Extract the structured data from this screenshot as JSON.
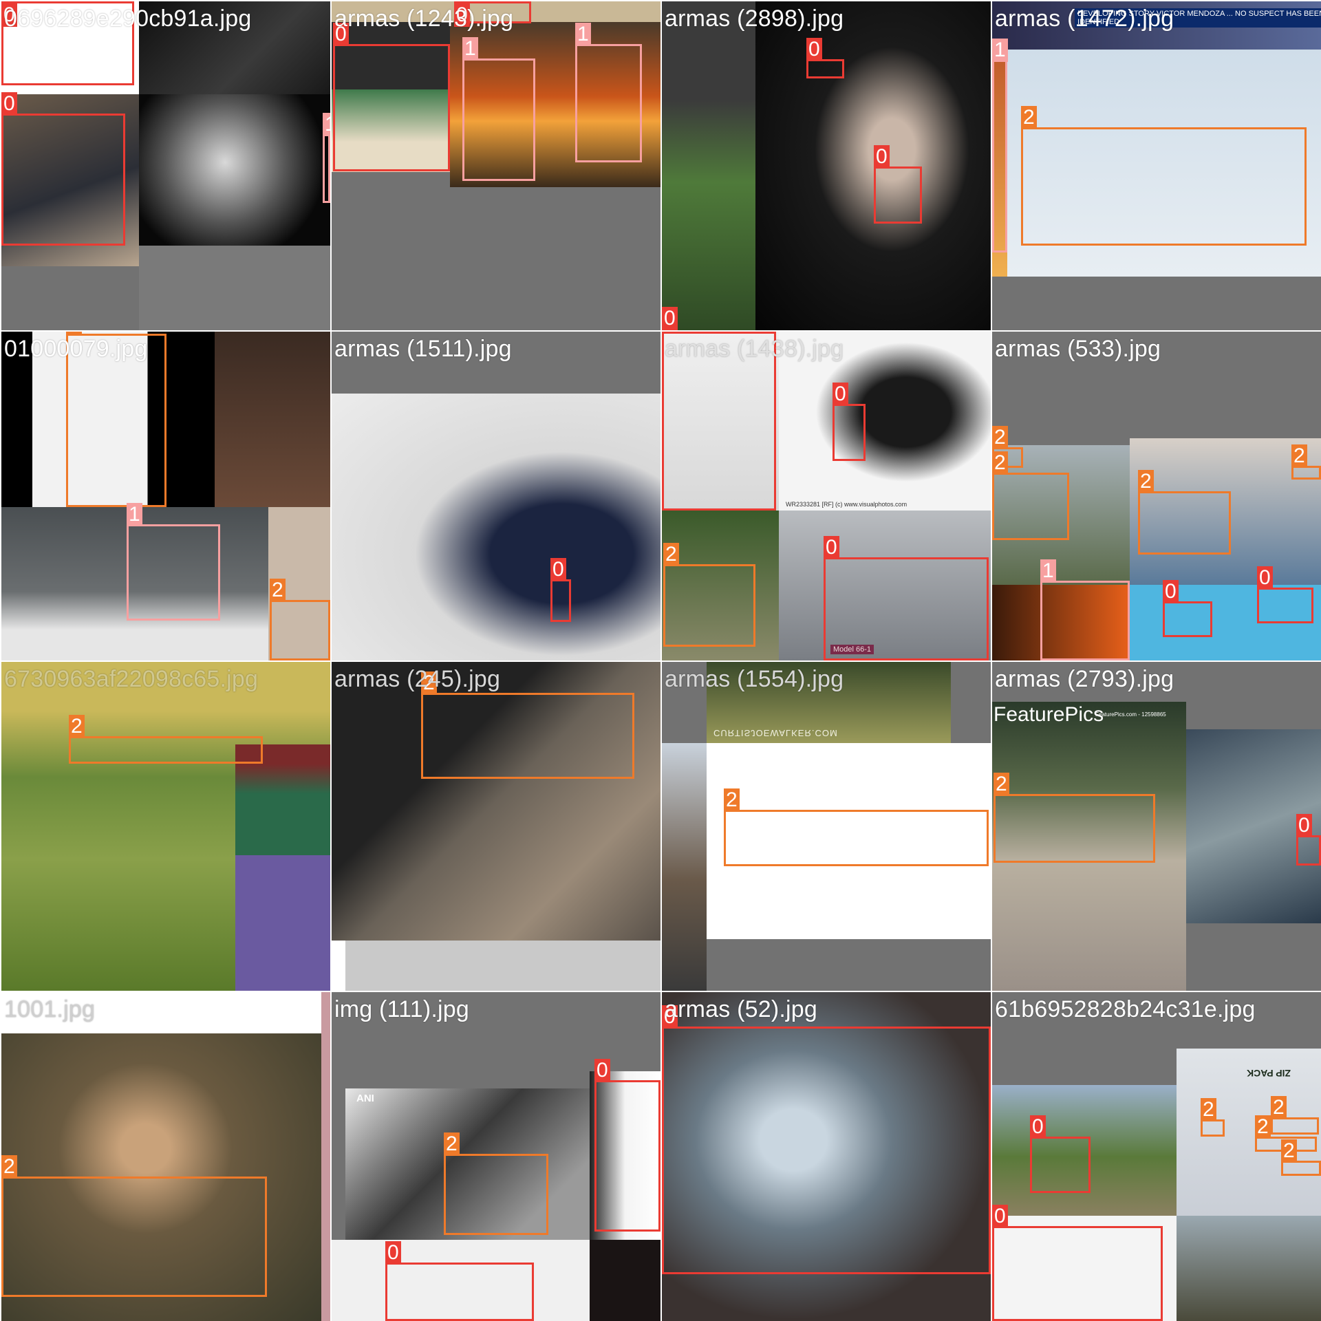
{
  "palette": {
    "background": "#727272",
    "class_colors": {
      "0": "#ea3b33",
      "1": "#f7a0a0",
      "2": "#ef7a2a"
    }
  },
  "tiles": [
    {
      "filename": "0696289e290cb91a.jpg",
      "labels": [
        "0",
        "0",
        "1"
      ]
    },
    {
      "filename": "armas (1243).jpg",
      "labels": [
        "0",
        "0",
        "1",
        "1"
      ]
    },
    {
      "filename": "armas (2898).jpg",
      "labels": [
        "0",
        "0",
        "0"
      ]
    },
    {
      "filename": "armas (1472).jpg",
      "labels": [
        "1",
        "2"
      ],
      "caption": "DEVELOPING STORY VICTOR MENDOZA ... NO SUSPECT HAS BEEN IDENTIFIED"
    },
    {
      "filename": "01000079.jpg",
      "labels": [
        "2",
        "1",
        "2"
      ]
    },
    {
      "filename": "armas (1511).jpg",
      "labels": [
        "0"
      ]
    },
    {
      "filename": "armas (1438).jpg",
      "labels": [
        "0",
        "2",
        "0"
      ],
      "caption": "WR2333281 [RF] (c) www.visualphotos.com",
      "sign": "Model 66-1"
    },
    {
      "filename": "armas (533).jpg",
      "labels": [
        "2",
        "2",
        "2",
        "2",
        "1",
        "0",
        "0"
      ]
    },
    {
      "filename": "6730963af22098c65.jpg",
      "labels": [
        "2"
      ]
    },
    {
      "filename": "armas (245).jpg",
      "labels": [
        "2"
      ]
    },
    {
      "filename": "armas (1554).jpg",
      "labels": [
        "2"
      ],
      "watermark": "CURTISJOEWALKER.COM"
    },
    {
      "filename": "armas (2793).jpg",
      "labels": [
        "2",
        "0"
      ],
      "watermark": "FeaturePics",
      "watermark_sub": "FeaturePics.com - 12598865"
    },
    {
      "filename": "1001.jpg",
      "labels": [
        "2"
      ]
    },
    {
      "filename": "img (111).jpg",
      "labels": [
        "0",
        "2",
        "0"
      ],
      "watermark": "ANI"
    },
    {
      "filename": "armas (52).jpg",
      "labels": [
        "0"
      ]
    },
    {
      "filename": "61b6952828b24c31e.jpg",
      "labels": [
        "0",
        "2",
        "2",
        "2",
        "2",
        "0"
      ],
      "sign": "ZIP PACK"
    }
  ]
}
